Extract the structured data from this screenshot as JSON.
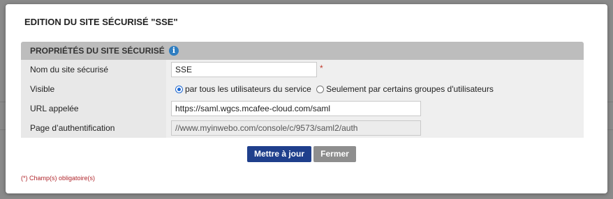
{
  "dialog": {
    "title": "EDITION DU SITE SÉCURISÉ \"SSE\""
  },
  "section": {
    "title": "PROPRIÉTÉS DU SITE SÉCURISÉ",
    "info_icon": "info-icon"
  },
  "fields": {
    "name": {
      "label": "Nom du site sécurisé",
      "value": "SSE",
      "required_mark": "*"
    },
    "visible": {
      "label": "Visible",
      "options": [
        {
          "label": "par tous les utilisateurs du service",
          "checked": true
        },
        {
          "label": "Seulement par certains groupes d'utilisateurs",
          "checked": false
        }
      ]
    },
    "url": {
      "label": "URL appelée",
      "value": "https://saml.wgcs.mcafee-cloud.com/saml"
    },
    "auth_page": {
      "label": "Page d’authentification",
      "value": "//www.myinwebo.com/console/c/9573/saml2/auth"
    }
  },
  "buttons": {
    "save": "Mettre à jour",
    "close": "Fermer"
  },
  "footnote": "(*) Champ(s) obligatoire(s)",
  "colors": {
    "primary_button": "#1f3f8c",
    "secondary_button": "#8e8e8e",
    "section_header": "#bdbdbd",
    "required": "#c0392b",
    "info_icon": "#2f7ec1"
  }
}
